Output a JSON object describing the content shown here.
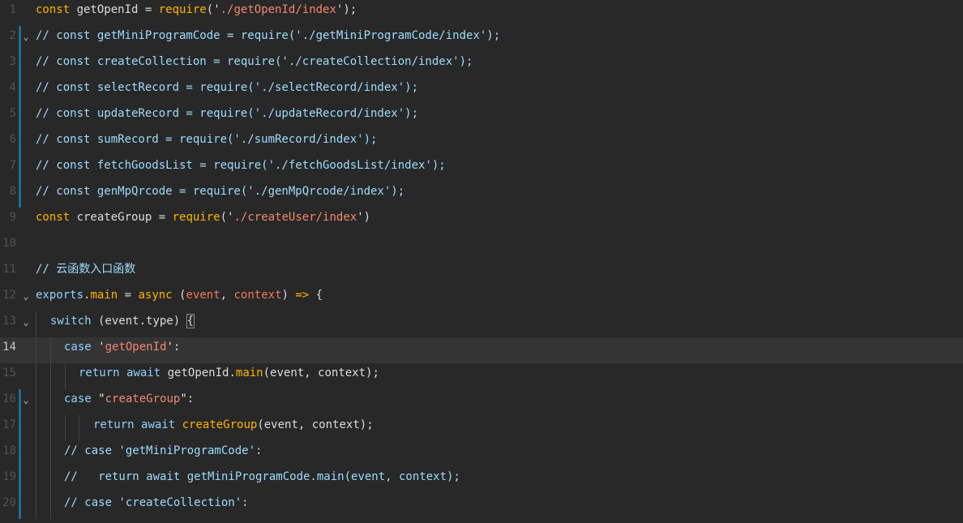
{
  "editor": {
    "lines": [
      {
        "num": "1",
        "segments": [
          {
            "t": "const ",
            "c": "kw2"
          },
          {
            "t": "getOpenId",
            "c": "pun"
          },
          {
            "t": " = ",
            "c": "pun"
          },
          {
            "t": "require",
            "c": "fn"
          },
          {
            "t": "(",
            "c": "pun"
          },
          {
            "t": "'",
            "c": "str-q"
          },
          {
            "t": "./getOpenId/index",
            "c": "str"
          },
          {
            "t": "'",
            "c": "str-q"
          },
          {
            "t": ");",
            "c": "pun"
          }
        ]
      },
      {
        "num": "2",
        "segments": [
          {
            "t": "// const getMiniProgramCode = require('./getMiniProgramCode/index');",
            "c": "cmt"
          }
        ]
      },
      {
        "num": "3",
        "segments": [
          {
            "t": "// const createCollection = require('./createCollection/index');",
            "c": "cmt"
          }
        ]
      },
      {
        "num": "4",
        "segments": [
          {
            "t": "// const selectRecord = require('./selectRecord/index');",
            "c": "cmt"
          }
        ]
      },
      {
        "num": "5",
        "segments": [
          {
            "t": "// const updateRecord = require('./updateRecord/index');",
            "c": "cmt"
          }
        ]
      },
      {
        "num": "6",
        "segments": [
          {
            "t": "// const sumRecord = require('./sumRecord/index');",
            "c": "cmt"
          }
        ]
      },
      {
        "num": "7",
        "segments": [
          {
            "t": "// const fetchGoodsList = require('./fetchGoodsList/index');",
            "c": "cmt"
          }
        ]
      },
      {
        "num": "8",
        "segments": [
          {
            "t": "// const genMpQrcode = require('./genMpQrcode/index');",
            "c": "cmt"
          }
        ]
      },
      {
        "num": "9",
        "segments": [
          {
            "t": "const ",
            "c": "kw2"
          },
          {
            "t": "createGroup",
            "c": "pun"
          },
          {
            "t": " = ",
            "c": "pun"
          },
          {
            "t": "require",
            "c": "fn"
          },
          {
            "t": "(",
            "c": "pun"
          },
          {
            "t": "'",
            "c": "str-q"
          },
          {
            "t": "./createUser/index",
            "c": "str"
          },
          {
            "t": "'",
            "c": "str-q"
          },
          {
            "t": ")",
            "c": "pun"
          }
        ]
      },
      {
        "num": "10",
        "segments": []
      },
      {
        "num": "11",
        "segments": [
          {
            "t": "// 云函数入口函数",
            "c": "cmt"
          }
        ]
      },
      {
        "num": "12",
        "segments": [
          {
            "t": "exports",
            "c": "ctl"
          },
          {
            "t": ".",
            "c": "pun"
          },
          {
            "t": "main",
            "c": "fn"
          },
          {
            "t": " = ",
            "c": "pun"
          },
          {
            "t": "async",
            "c": "kw2"
          },
          {
            "t": " (",
            "c": "pun"
          },
          {
            "t": "event",
            "c": "prm"
          },
          {
            "t": ", ",
            "c": "pun"
          },
          {
            "t": "context",
            "c": "prm"
          },
          {
            "t": ") ",
            "c": "pun"
          },
          {
            "t": "=>",
            "c": "kw2"
          },
          {
            "t": " {",
            "c": "pun"
          }
        ]
      },
      {
        "num": "13",
        "segments": [
          {
            "t": "switch",
            "c": "ctl"
          },
          {
            "t": " (event.type) ",
            "c": "pun"
          },
          {
            "t": "{",
            "c": "pun",
            "hl": true
          }
        ]
      },
      {
        "num": "14",
        "segments": [
          {
            "t": "case",
            "c": "ctl"
          },
          {
            "t": " ",
            "c": "pun"
          },
          {
            "t": "'",
            "c": "str-q"
          },
          {
            "t": "getOpenId",
            "c": "str"
          },
          {
            "t": "'",
            "c": "str-q"
          },
          {
            "t": ":",
            "c": "pun"
          }
        ]
      },
      {
        "num": "15",
        "segments": [
          {
            "t": "return",
            "c": "ctl"
          },
          {
            "t": " ",
            "c": "pun"
          },
          {
            "t": "await",
            "c": "ctl"
          },
          {
            "t": " getOpenId.",
            "c": "pun"
          },
          {
            "t": "main",
            "c": "fn"
          },
          {
            "t": "(event, context);",
            "c": "pun"
          }
        ]
      },
      {
        "num": "16",
        "segments": [
          {
            "t": "case",
            "c": "ctl"
          },
          {
            "t": " ",
            "c": "pun"
          },
          {
            "t": "\"",
            "c": "str-q"
          },
          {
            "t": "createGroup",
            "c": "str"
          },
          {
            "t": "\"",
            "c": "str-q"
          },
          {
            "t": ":",
            "c": "pun"
          }
        ]
      },
      {
        "num": "17",
        "segments": [
          {
            "t": "return",
            "c": "ctl"
          },
          {
            "t": " ",
            "c": "pun"
          },
          {
            "t": "await",
            "c": "ctl"
          },
          {
            "t": " ",
            "c": "pun"
          },
          {
            "t": "createGroup",
            "c": "fn"
          },
          {
            "t": "(event, context);",
            "c": "pun"
          }
        ]
      },
      {
        "num": "18",
        "segments": [
          {
            "t": "// case 'getMiniProgramCode':",
            "c": "cmt"
          }
        ]
      },
      {
        "num": "19",
        "segments": [
          {
            "t": "//   return await getMiniProgramCode.main(event, context);",
            "c": "cmt"
          }
        ]
      },
      {
        "num": "20",
        "segments": [
          {
            "t": "// case 'createCollection':",
            "c": "cmt"
          }
        ]
      }
    ]
  }
}
